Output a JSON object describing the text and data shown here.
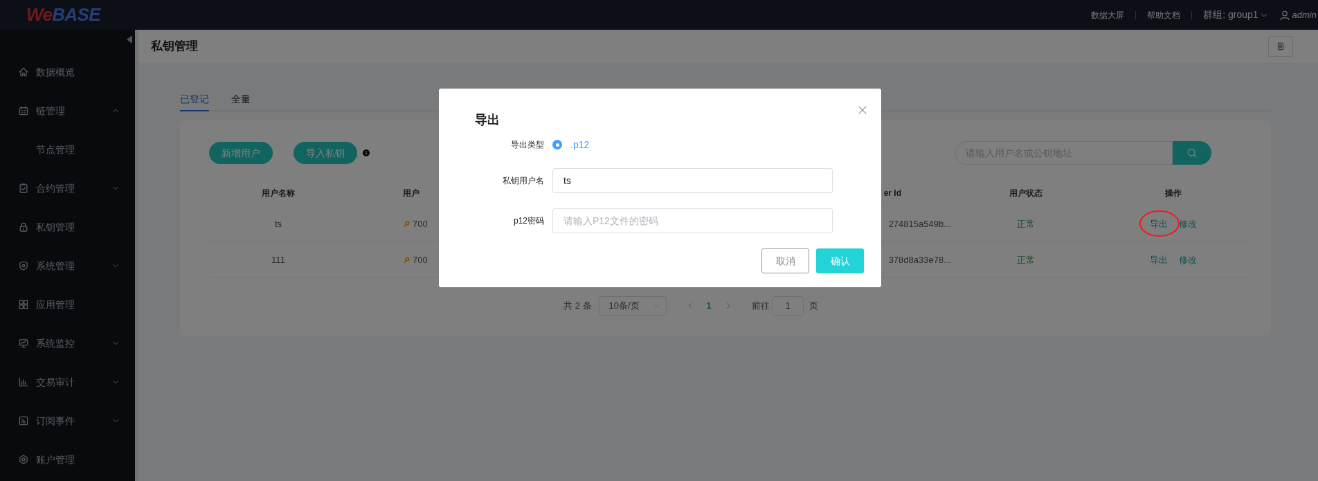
{
  "header": {
    "logo": "WeBASE",
    "links": [
      "数据大屏",
      "帮助文档"
    ],
    "group": "群组: group1",
    "user": "admin"
  },
  "sidebar": {
    "items": [
      {
        "label": "数据概览",
        "kind": "link"
      },
      {
        "label": "链管理",
        "kind": "group",
        "expanded": true,
        "children": [
          {
            "label": "节点管理"
          }
        ]
      },
      {
        "label": "合约管理",
        "kind": "group",
        "expanded": false
      },
      {
        "label": "私钥管理",
        "kind": "link"
      },
      {
        "label": "系统管理",
        "kind": "group",
        "expanded": false
      },
      {
        "label": "应用管理",
        "kind": "link"
      },
      {
        "label": "系统监控",
        "kind": "group",
        "expanded": false
      },
      {
        "label": "交易审计",
        "kind": "group",
        "expanded": false
      },
      {
        "label": "订阅事件",
        "kind": "group",
        "expanded": false
      },
      {
        "label": "账户管理",
        "kind": "link"
      }
    ]
  },
  "page": {
    "title": "私钥管理"
  },
  "tabs": [
    {
      "label": "已登记",
      "selected": true
    },
    {
      "label": "全量",
      "selected": false
    }
  ],
  "toolbar": {
    "buttons": [
      "新增用户",
      "导入私钥"
    ],
    "search": {
      "placeholder": "请输入用户名或公钥地址"
    }
  },
  "table": {
    "columns": [
      "用户名称",
      "用户",
      "er Id",
      "用户状态",
      "操作"
    ],
    "rows": [
      {
        "name": "ts",
        "column_2": "700",
        "column_3": "274815a549b...",
        "status": "正常",
        "actions": [
          "导出",
          "修改"
        ],
        "circled": true
      },
      {
        "name": "111",
        "column_2": "700",
        "column_3": "378d8a33e78...",
        "status": "正常",
        "actions": [
          "导出",
          "修改"
        ],
        "circled": false
      }
    ]
  },
  "pagination": {
    "total": "共 2 条",
    "page_size": "10条/页",
    "pages": [
      {
        "label": "1",
        "selected": true
      }
    ],
    "goto_label": "前往",
    "goto_value": "1",
    "goto_suffix": "页"
  },
  "dialog": {
    "title": "导出",
    "fields": [
      {
        "kind": "radio",
        "label": "导出类型",
        "option": ".p12",
        "checked": true
      },
      {
        "kind": "input",
        "label": "私钥用户名",
        "value": "ts"
      },
      {
        "kind": "input",
        "label": "p12密码",
        "placeholder": "请输入P12文件的密码"
      }
    ],
    "buttons": [
      {
        "label": "取消",
        "kind": "secondary"
      },
      {
        "label": "确认",
        "kind": "primary"
      }
    ]
  }
}
